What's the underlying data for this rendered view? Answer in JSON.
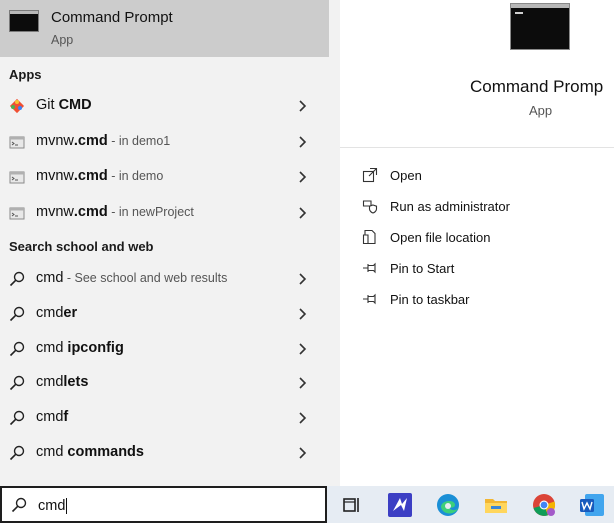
{
  "best_match": {
    "title": "Command Prompt",
    "subtitle": "App"
  },
  "sections": {
    "apps": "Apps",
    "web": "Search school and web"
  },
  "apps": [
    {
      "name_pre": "Git ",
      "name_bold": "CMD",
      "name_post": "",
      "hint": "",
      "icon": "git-icon"
    },
    {
      "name_pre": "mvnw",
      "name_bold": ".cmd",
      "name_post": "",
      "hint": " - in demo1",
      "icon": "cmd-file-icon"
    },
    {
      "name_pre": "mvnw",
      "name_bold": ".cmd",
      "name_post": "",
      "hint": " - in demo",
      "icon": "cmd-file-icon"
    },
    {
      "name_pre": "mvnw",
      "name_bold": ".cmd",
      "name_post": "",
      "hint": " - in newProject",
      "icon": "cmd-file-icon"
    }
  ],
  "web_results": [
    {
      "pre": "cmd",
      "bold": "",
      "hint": " - See school and web results"
    },
    {
      "pre": "cmd",
      "bold": "er",
      "hint": ""
    },
    {
      "pre": "cmd ",
      "bold": "ipconfig",
      "hint": ""
    },
    {
      "pre": "cmd",
      "bold": "lets",
      "hint": ""
    },
    {
      "pre": "cmd",
      "bold": "f",
      "hint": ""
    },
    {
      "pre": "cmd ",
      "bold": "commands",
      "hint": ""
    }
  ],
  "detail": {
    "title": "Command Promp",
    "subtitle": "App",
    "actions": [
      {
        "label": "Open",
        "icon": "open-icon"
      },
      {
        "label": "Run as administrator",
        "icon": "shield-icon"
      },
      {
        "label": "Open file location",
        "icon": "file-location-icon"
      },
      {
        "label": "Pin to Start",
        "icon": "pin-icon"
      },
      {
        "label": "Pin to taskbar",
        "icon": "pin-icon"
      }
    ]
  },
  "search": {
    "value": "cmd"
  },
  "taskbar": {
    "icons": [
      "task-view-icon",
      "visual-studio-icon",
      "edge-icon",
      "file-explorer-icon",
      "chrome-icon",
      "word-icon"
    ]
  },
  "colors": {
    "selected_bg": "#cccccc",
    "panel_bg": "#f2f2f2",
    "detail_bg": "#ffffff"
  }
}
